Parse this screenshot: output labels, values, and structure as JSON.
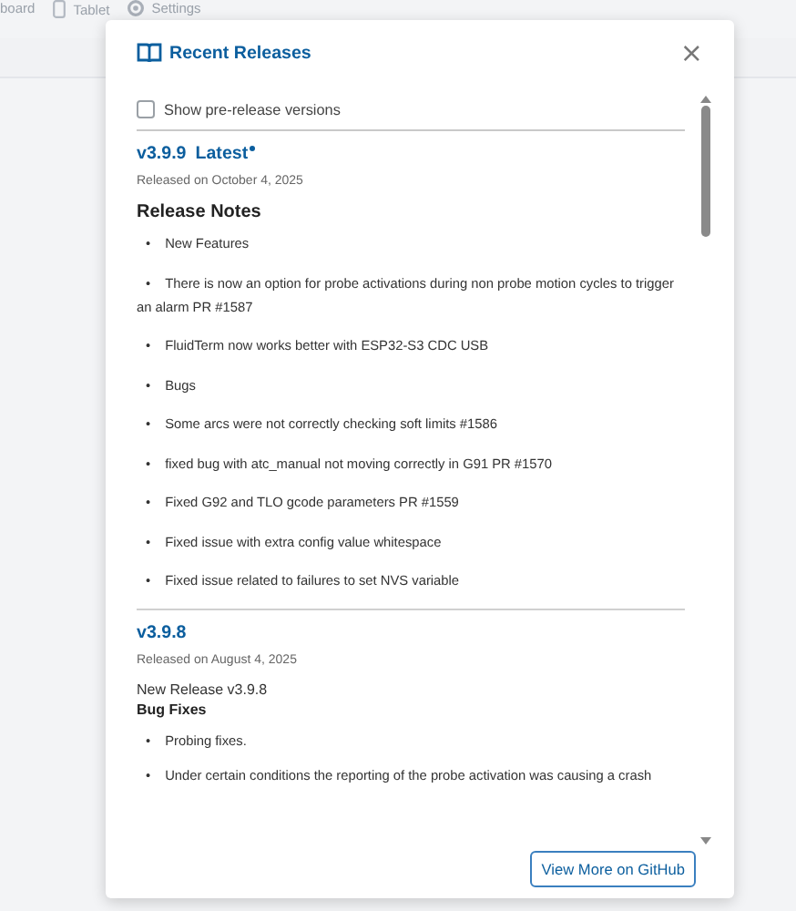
{
  "background_tabs": [
    {
      "label": "board"
    },
    {
      "label": "Tablet"
    },
    {
      "label": "Settings"
    }
  ],
  "dialog": {
    "title": "Recent Releases",
    "close": "×",
    "prerelease": {
      "label": "Show pre-release versions",
      "checked": false
    },
    "releases": [
      {
        "version": "v3.9.9",
        "badge": "Latest",
        "date": "Released on October 4, 2025",
        "heading": "Release Notes",
        "notes": [
          {
            "bullet": "•",
            "text": "New Features"
          },
          {
            "bullet": "•",
            "text": "There is now an option for probe activations during non probe motion cycles to trigger an alarm PR #1587"
          },
          {
            "bullet": "•",
            "text": "FluidTerm now works better with ESP32-S3 CDC USB"
          },
          {
            "bullet": "•",
            "text": "Bugs"
          },
          {
            "bullet": "•",
            "text": "Some arcs were not correctly checking soft limits #1586"
          },
          {
            "bullet": "•",
            "text": "fixed bug with atc_manual not moving correctly in G91 PR #1570"
          },
          {
            "bullet": "•",
            "text": "Fixed G92 and TLO gcode parameters PR #1559"
          },
          {
            "bullet": "•",
            "text": "Fixed issue with extra config value whitespace"
          },
          {
            "bullet": "•",
            "text": "Fixed issue related to failures to set NVS variable"
          }
        ]
      },
      {
        "version": "v3.9.8",
        "date": "Released on August 4, 2025",
        "intro": [
          "New Release v3.9.8"
        ],
        "subheading": "Bug Fixes",
        "notes": [
          {
            "bullet": "•",
            "text": "Probing fixes."
          },
          {
            "bullet": "•",
            "text": "Under certain conditions the reporting of the probe activation was causing a crash"
          }
        ]
      }
    ],
    "footer_button": "View More on GitHub"
  }
}
